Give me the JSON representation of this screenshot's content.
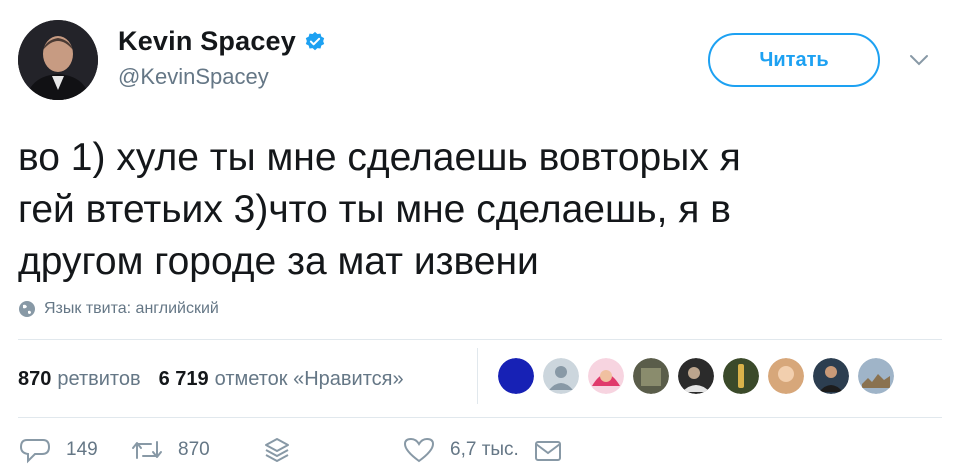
{
  "author": {
    "name": "Kevin Spacey",
    "handle": "@KevinSpacey",
    "verified_color": "#1da1f2"
  },
  "follow_label": "Читать",
  "tweet": {
    "lines": [
      "во 1) хуле ты мне сделаешь вовторых я",
      "гей втетьих 3)что ты мне сделаешь, я в",
      "другом городе за мат извени"
    ],
    "language_note": "Язык твита: английский"
  },
  "stats": {
    "retweets_count": "870",
    "retweets_label": "ретвитов",
    "likes_count": "6 719",
    "likes_label": "отметок «Нравится»"
  },
  "liker_avatars": 9,
  "actions": {
    "reply_count": "149",
    "retweet_count": "870",
    "like_count": "6,7 тыс."
  },
  "icons": [
    "verified-badge-icon",
    "chevron-down-icon",
    "globe-icon",
    "reply-icon",
    "retweet-icon",
    "stack-icon",
    "heart-icon",
    "mail-icon"
  ],
  "colors": {
    "accent": "#1da1f2",
    "muted": "#657786",
    "text": "#14171a"
  }
}
